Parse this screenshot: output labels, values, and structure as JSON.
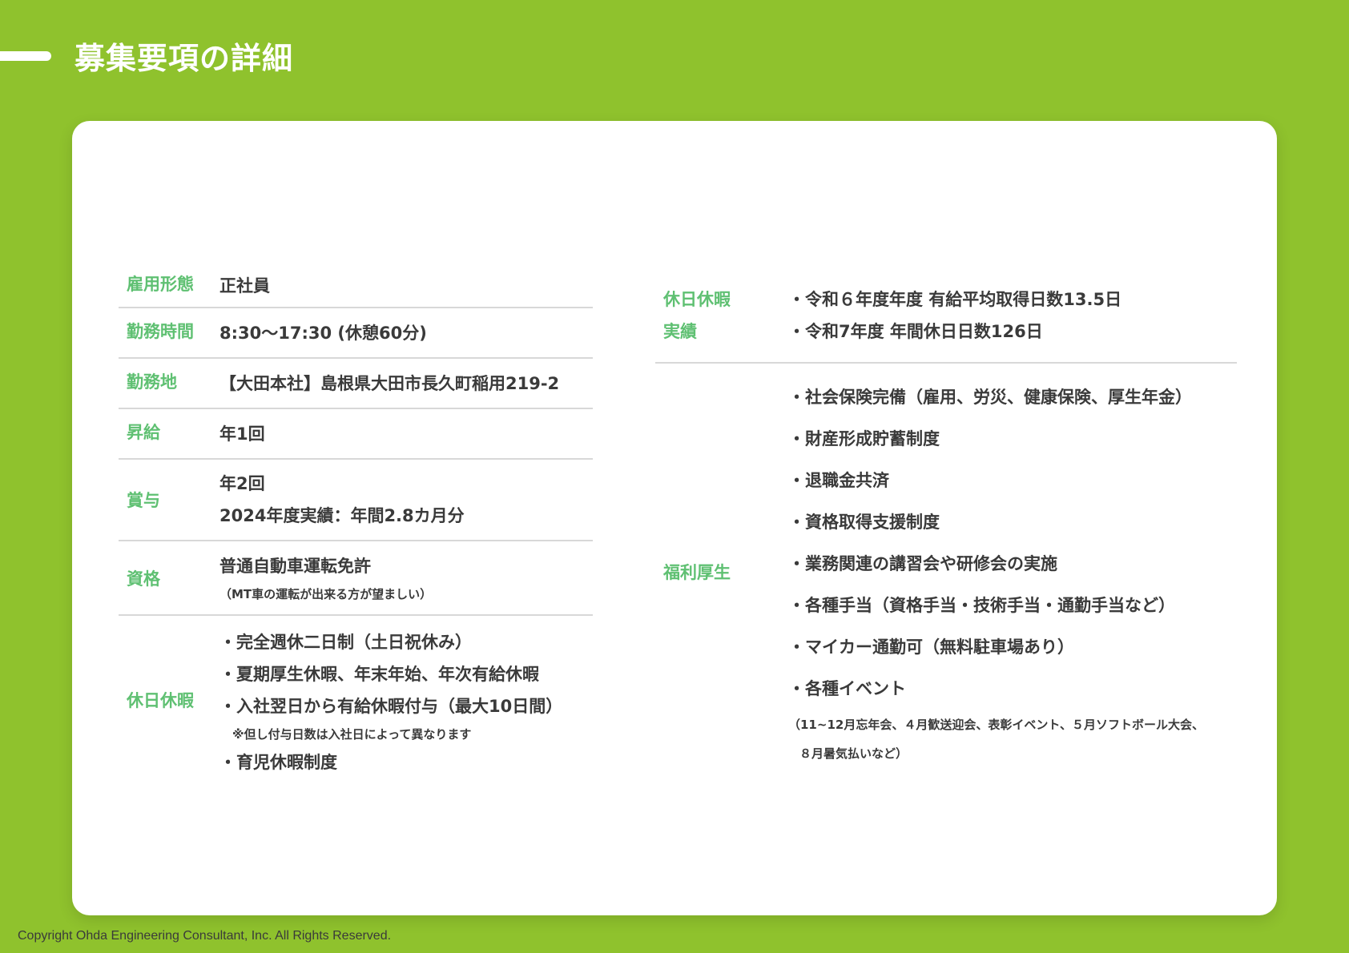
{
  "header": {
    "title": "募集要項の詳細"
  },
  "left_rows": [
    {
      "label": "雇用形態",
      "lines": [
        "正社員"
      ]
    },
    {
      "label": "勤務時間",
      "lines": [
        "8:30～17:30 (休憩60分)"
      ]
    },
    {
      "label": "勤務地",
      "lines": [
        "【大田本社】島根県大田市長久町稲用219-2"
      ]
    },
    {
      "label": "昇給",
      "lines": [
        "年1回"
      ]
    },
    {
      "label": "賞与",
      "lines": [
        "年2回",
        "2024年度実績：年間2.8カ月分"
      ]
    },
    {
      "label": "資格",
      "lines": [
        "普通自動車運転免許"
      ],
      "note": "（MT車の運転が出来る方が望ましい）"
    },
    {
      "label": "休日休暇",
      "lines": [
        "・完全週休二日制（土日祝休み）",
        "・夏期厚生休暇、年末年始、年次有給休暇",
        "・入社翌日から有給休暇付与（最大10日間）"
      ],
      "note": "※但し付与日数は入社日によって異なります",
      "after": "・育児休暇制度"
    }
  ],
  "right_rows": [
    {
      "label1": "休日休暇",
      "label2": "実績",
      "lines": [
        "・令和６年度年度 有給平均取得日数13.5日",
        "・令和7年度 年間休日日数126日"
      ]
    },
    {
      "label": "福利厚生",
      "lines": [
        "・社会保険完備（雇用、労災、健康保険、厚生年金）",
        "・財産形成貯蓄制度",
        "・退職金共済",
        "・資格取得支援制度",
        "・業務関連の講習会や研修会の実施",
        "・各種手当（資格手当・技術手当・通勤手当など）",
        "・マイカー通勤可（無料駐車場あり）",
        "・各種イベント"
      ],
      "note1": "（11~12月忘年会、４月歓送迎会、表彰イベント、５月ソフトボール大会、",
      "note2": "８月暑気払いなど）"
    }
  ],
  "footer": {
    "copyright": "Copyright Ohda Engineering Consultant, Inc. All Rights Reserved."
  },
  "colors": {
    "background": "#8fc22d",
    "label": "#5fc072",
    "text": "#3a3a3a"
  }
}
